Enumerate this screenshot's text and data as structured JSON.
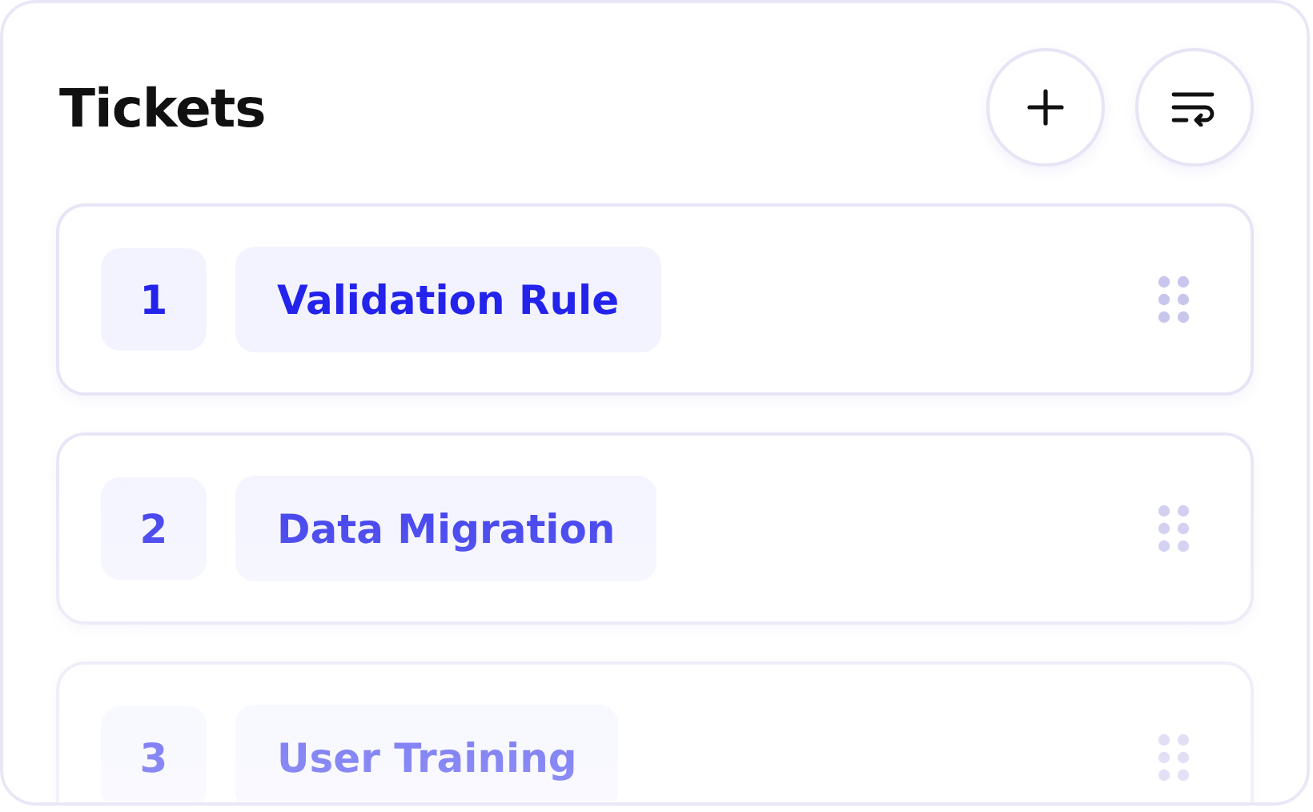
{
  "header": {
    "title": "Tickets"
  },
  "tickets": [
    {
      "number": "1",
      "label": "Validation Rule"
    },
    {
      "number": "2",
      "label": "Data Migration"
    },
    {
      "number": "3",
      "label": "User Training"
    }
  ]
}
